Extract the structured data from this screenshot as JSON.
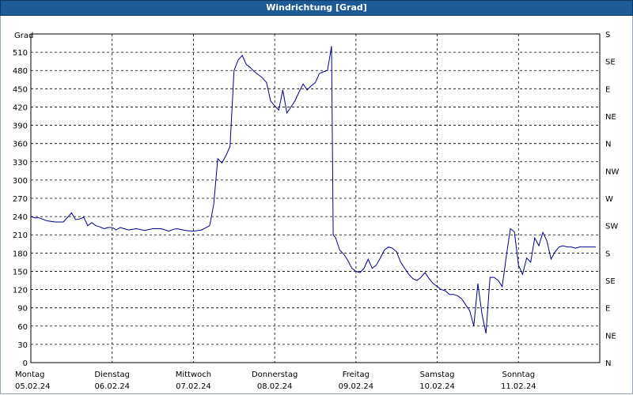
{
  "window": {
    "title": "Windrichtung [Grad]"
  },
  "chart_data": {
    "type": "line",
    "title": "Windrichtung [Grad]",
    "ylabel": "Grad",
    "ylim": [
      0,
      540
    ],
    "yticks": [
      0,
      30,
      60,
      90,
      120,
      150,
      180,
      210,
      240,
      270,
      300,
      330,
      360,
      390,
      420,
      450,
      480,
      510
    ],
    "y2ticks": [
      {
        "value": 0,
        "label": "N"
      },
      {
        "value": 45,
        "label": "NE"
      },
      {
        "value": 90,
        "label": "E"
      },
      {
        "value": 135,
        "label": "SE"
      },
      {
        "value": 180,
        "label": "S"
      },
      {
        "value": 225,
        "label": "SW"
      },
      {
        "value": 270,
        "label": "W"
      },
      {
        "value": 315,
        "label": "NW"
      },
      {
        "value": 360,
        "label": "N"
      },
      {
        "value": 405,
        "label": "NE"
      },
      {
        "value": 450,
        "label": "E"
      },
      {
        "value": 495,
        "label": "SE"
      },
      {
        "value": 540,
        "label": "S"
      }
    ],
    "xlim": [
      0,
      7
    ],
    "xlabels": [
      {
        "day": "Montag",
        "date": "05.02.24",
        "x": 0
      },
      {
        "day": "Dienstag",
        "date": "06.02.24",
        "x": 1
      },
      {
        "day": "Mittwoch",
        "date": "07.02.24",
        "x": 2
      },
      {
        "day": "Donnerstag",
        "date": "08.02.24",
        "x": 3
      },
      {
        "day": "Freitag",
        "date": "09.02.24",
        "x": 4
      },
      {
        "day": "Samstag",
        "date": "10.02.24",
        "x": 5
      },
      {
        "day": "Sonntag",
        "date": "11.02.24",
        "x": 6
      }
    ],
    "grid": true,
    "line_color": "#00008b",
    "series": [
      {
        "x": [
          0,
          0.05,
          0.1,
          0.2,
          0.3,
          0.4,
          0.5,
          0.55,
          0.6,
          0.65,
          0.7,
          0.75,
          0.8,
          0.85,
          0.9,
          0.95,
          1.0,
          1.05,
          1.1,
          1.15,
          1.2,
          1.3,
          1.4,
          1.5,
          1.6,
          1.7,
          1.75,
          1.8,
          1.9,
          2.0,
          2.1,
          2.2,
          2.25,
          2.3,
          2.35,
          2.4,
          2.45,
          2.5,
          2.55,
          2.6,
          2.65,
          2.7,
          2.75,
          2.8,
          2.85,
          2.9,
          2.95,
          3.0,
          3.05,
          3.1,
          3.15,
          3.2,
          3.25,
          3.3,
          3.35,
          3.4,
          3.45,
          3.5,
          3.55,
          3.6,
          3.65,
          3.7,
          3.72,
          3.75,
          3.8,
          3.85,
          3.9,
          3.95,
          4.0,
          4.05,
          4.1,
          4.15,
          4.2,
          4.25,
          4.3,
          4.35,
          4.4,
          4.45,
          4.5,
          4.55,
          4.6,
          4.65,
          4.7,
          4.75,
          4.8,
          4.85,
          4.9,
          4.95,
          5.0,
          5.05,
          5.1,
          5.15,
          5.2,
          5.25,
          5.3,
          5.35,
          5.4,
          5.45,
          5.5,
          5.55,
          5.6,
          5.65,
          5.7,
          5.75,
          5.8,
          5.85,
          5.9,
          5.95,
          6.0,
          6.05,
          6.1,
          6.15,
          6.2,
          6.25,
          6.3,
          6.35,
          6.4,
          6.45,
          6.5,
          6.55,
          6.6,
          6.65,
          6.7,
          6.75,
          6.8,
          6.85,
          6.9,
          6.95
        ],
        "y": [
          240,
          238,
          238,
          233,
          231,
          231,
          246,
          235,
          236,
          239,
          225,
          230,
          225,
          223,
          220,
          222,
          222,
          218,
          222,
          220,
          218,
          220,
          217,
          220,
          220,
          216,
          219,
          220,
          217,
          216,
          218,
          225,
          260,
          335,
          328,
          340,
          355,
          480,
          497,
          505,
          490,
          485,
          478,
          473,
          468,
          460,
          430,
          422,
          415,
          448,
          410,
          420,
          430,
          445,
          458,
          448,
          455,
          460,
          475,
          478,
          480,
          520,
          210,
          205,
          185,
          178,
          168,
          155,
          150,
          148,
          155,
          170,
          155,
          160,
          172,
          185,
          190,
          188,
          182,
          165,
          155,
          145,
          138,
          135,
          140,
          148,
          138,
          130,
          125,
          120,
          118,
          112,
          112,
          110,
          105,
          95,
          85,
          60,
          130,
          80,
          48,
          140,
          140,
          135,
          125,
          175,
          220,
          215,
          160,
          145,
          172,
          165,
          205,
          192,
          214,
          200,
          170,
          182,
          190,
          192,
          190,
          190,
          188,
          190,
          190,
          190,
          190,
          190
        ]
      }
    ]
  }
}
